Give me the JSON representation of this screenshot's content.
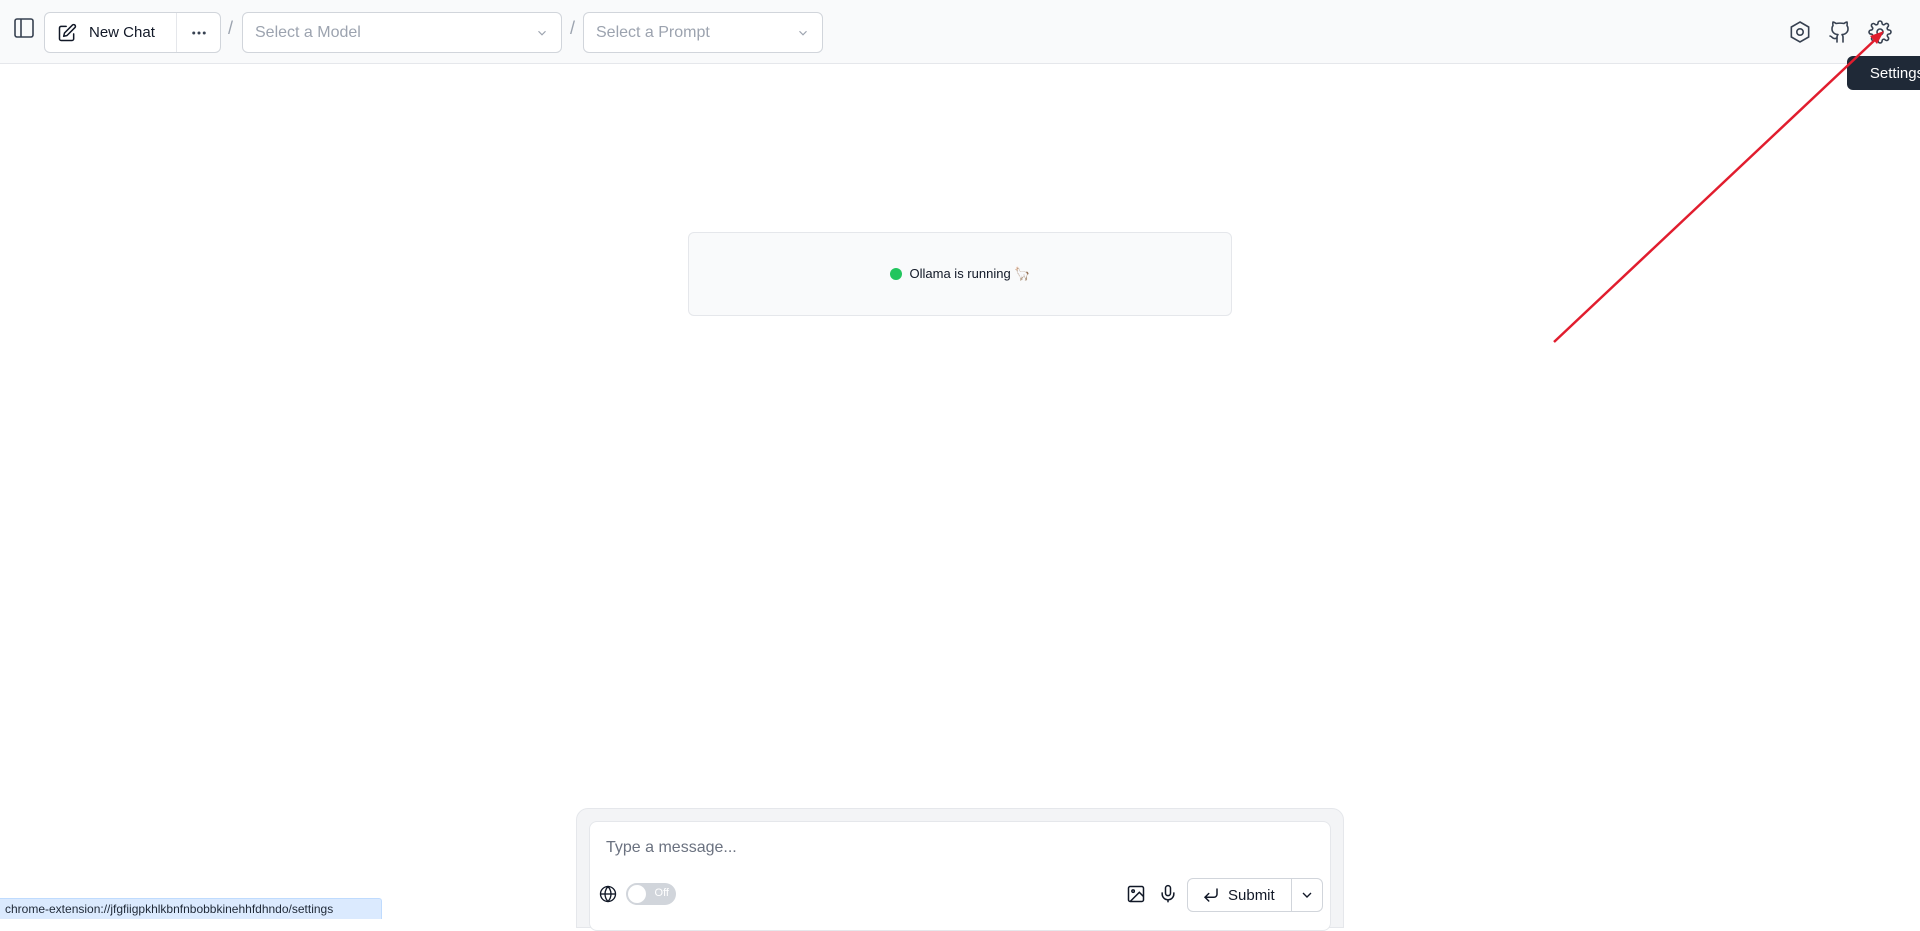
{
  "header": {
    "new_chat_label": "New Chat",
    "model_select_placeholder": "Select a Model",
    "prompt_select_placeholder": "Select a Prompt",
    "separator": "/"
  },
  "status": {
    "text": "Ollama is running 🦙",
    "color": "#22c55e"
  },
  "tooltip": {
    "text": "Settings"
  },
  "composer": {
    "placeholder": "Type a message...",
    "web_search_toggle": "Off",
    "submit_label": "Submit"
  },
  "statusbar": {
    "url": "chrome-extension://jfgfiigpkhlkbnfnbobbkinehhfdhndo/settings"
  },
  "icons": {
    "sidebar": "sidebar-toggle-icon",
    "edit": "edit-icon",
    "more": "more-horizontal-icon",
    "chevron": "chevron-down-icon",
    "ollama_settings": "ollama-settings-icon",
    "github": "github-icon",
    "settings": "settings-gear-icon",
    "globe": "globe-icon",
    "image": "image-icon",
    "mic": "microphone-icon",
    "enter": "enter-icon"
  },
  "annotation_color": "#e11d2e"
}
